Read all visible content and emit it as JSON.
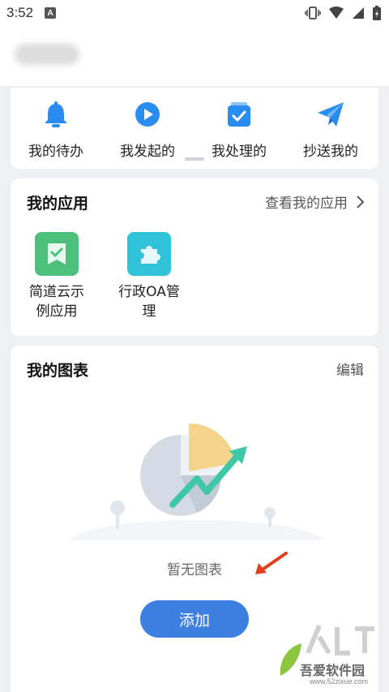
{
  "status_bar": {
    "time": "3:52",
    "notif_letter": "A"
  },
  "quick_actions": [
    {
      "label": "我的待办",
      "icon": "bell-icon"
    },
    {
      "label": "我发起的",
      "icon": "play-circle-icon"
    },
    {
      "label": "我处理的",
      "icon": "check-tray-icon"
    },
    {
      "label": "抄送我的",
      "icon": "paper-plane-icon"
    }
  ],
  "my_apps": {
    "title": "我的应用",
    "link": "查看我的应用",
    "items": [
      {
        "line1": "简道云示",
        "line2": "例应用",
        "icon": "bookmark-check-icon",
        "color": "#4cc07c"
      },
      {
        "line1": "行政OA管",
        "line2": "理",
        "icon": "puzzle-icon",
        "color": "#2fc2d8"
      }
    ]
  },
  "my_charts": {
    "title": "我的图表",
    "edit": "编辑",
    "empty": "暂无图表",
    "add": "添加"
  },
  "watermark": {
    "name": "吾爱软件园",
    "url": "www.52zixue.com"
  },
  "colors": {
    "accent": "#3d7fe0",
    "icon_blue": "#2a8cf0"
  }
}
